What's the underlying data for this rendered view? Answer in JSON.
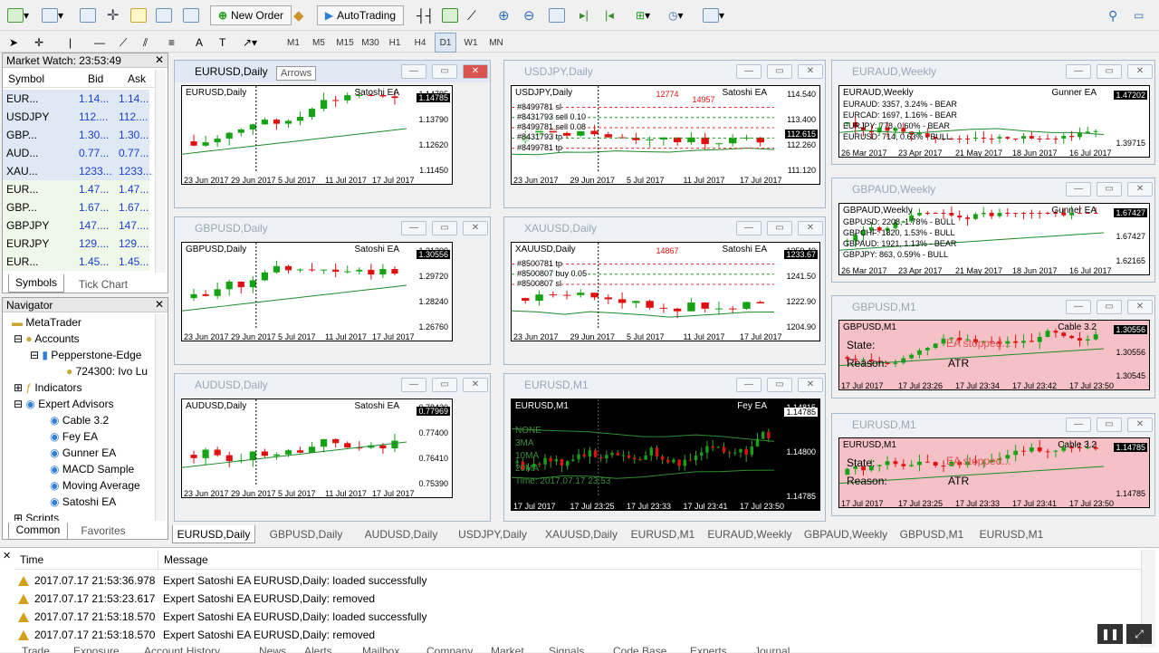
{
  "toolbar": {
    "new_order": "New Order",
    "autotrading": "AutoTrading"
  },
  "timeframes": [
    "M1",
    "M5",
    "M15",
    "M30",
    "H1",
    "H4",
    "D1",
    "W1",
    "MN"
  ],
  "market_watch": {
    "title": "Market Watch: 23:53:49",
    "headers": {
      "symbol": "Symbol",
      "bid": "Bid",
      "ask": "Ask"
    },
    "rows": [
      {
        "symbol": "EUR...",
        "bid": "1.14...",
        "ask": "1.14..."
      },
      {
        "symbol": "USDJPY",
        "bid": "112....",
        "ask": "112...."
      },
      {
        "symbol": "GBP...",
        "bid": "1.30...",
        "ask": "1.30..."
      },
      {
        "symbol": "AUD...",
        "bid": "0.77...",
        "ask": "0.77..."
      },
      {
        "symbol": "XAU...",
        "bid": "1233....",
        "ask": "1233...."
      },
      {
        "symbol": "EUR...",
        "bid": "1.47...",
        "ask": "1.47..."
      },
      {
        "symbol": "GBP...",
        "bid": "1.67...",
        "ask": "1.67..."
      },
      {
        "symbol": "GBPJPY",
        "bid": "147....",
        "ask": "147...."
      },
      {
        "symbol": "EURJPY",
        "bid": "129....",
        "ask": "129...."
      },
      {
        "symbol": "EUR...",
        "bid": "1.45...",
        "ask": "1.45..."
      }
    ],
    "tabs": [
      "Symbols",
      "Tick Chart"
    ]
  },
  "navigator": {
    "title": "Navigator",
    "items": [
      "MetaTrader",
      "Accounts",
      "Pepperstone-Edge",
      "724300: Ivo Lu",
      "Indicators",
      "Expert Advisors",
      "Cable 3.2",
      "Fey EA",
      "Gunner EA",
      "MACD Sample",
      "Moving Average",
      "Satoshi EA",
      "Scripts"
    ],
    "tabs": [
      "Common",
      "Favorites"
    ]
  },
  "charts": [
    {
      "title": "EURUSD,Daily",
      "label": "EURUSD,Daily",
      "ea": "Satoshi EA",
      "prices": [
        "1.14785",
        "1.13790",
        "1.12620",
        "1.11450"
      ],
      "dates": [
        "23 Jun 2017",
        "29 Jun 2017",
        "5 Jul 2017",
        "11 Jul 2017",
        "17 Jul 2017"
      ],
      "tag": "1.14785",
      "tooltip": "Arrows"
    },
    {
      "title": "USDJPY,Daily",
      "label": "USDJPY,Daily",
      "ea": "Satoshi EA",
      "prices": [
        "114.540",
        "113.400",
        "112.260",
        "111.120"
      ],
      "dates": [
        "23 Jun 2017",
        "29 Jun 2017",
        "5 Jul 2017",
        "11 Jul 2017",
        "17 Jul 2017"
      ],
      "tag": "112.615",
      "orders": [
        "#8499781 sl",
        "#8431793 sell 0.10",
        "#8499781 sell 0.08",
        "#8431793 tp",
        "#8499781 tp"
      ],
      "marks": [
        "12774",
        "14957"
      ]
    },
    {
      "title": "GBPUSD,Daily",
      "label": "GBPUSD,Daily",
      "ea": "Satoshi EA",
      "prices": [
        "1.31200",
        "1.29720",
        "1.28240",
        "1.26760"
      ],
      "dates": [
        "23 Jun 2017",
        "29 Jun 2017",
        "5 Jul 2017",
        "11 Jul 2017",
        "17 Jul 2017"
      ],
      "tag": "1.30556"
    },
    {
      "title": "XAUUSD,Daily",
      "label": "XAUUSD,Daily",
      "ea": "Satoshi EA",
      "prices": [
        "1259.40",
        "1241.50",
        "1222.90",
        "1204.90"
      ],
      "dates": [
        "23 Jun 2017",
        "29 Jun 2017",
        "5 Jul 2017",
        "11 Jul 2017",
        "17 Jul 2017"
      ],
      "tag": "1233.67",
      "orders": [
        "#8500781 tp",
        "#8500807 buy 0.05",
        "#8500807 sl"
      ],
      "marks": [
        "14867"
      ]
    },
    {
      "title": "AUDUSD,Daily",
      "label": "AUDUSD,Daily",
      "ea": "Satoshi EA",
      "prices": [
        "0.78420",
        "0.77400",
        "0.76410",
        "0.75390"
      ],
      "dates": [
        "23 Jun 2017",
        "29 Jun 2017",
        "5 Jul 2017",
        "11 Jul 2017",
        "17 Jul 2017"
      ],
      "tag": "0.77969"
    },
    {
      "title": "EURUSD,M1",
      "label": "EURUSD,M1",
      "ea": "Fey EA",
      "prices": [
        "1.14815",
        "1.14800",
        "1.14785"
      ],
      "dates": [
        "17 Jul 2017",
        "17 Jul 23:25",
        "17 Jul 23:33",
        "17 Jul 23:41",
        "17 Jul 23:50"
      ],
      "tag": "1.14785",
      "overlay": [
        "NONE",
        "3MA",
        "10MA",
        "20MA",
        "Time: 2017.07.17 23:53"
      ]
    },
    {
      "title": "EURAUD,Weekly",
      "label": "EURAUD,Weekly",
      "ea": "Gunner EA",
      "prices": [
        "1.47202",
        "1.39715"
      ],
      "dates": [
        "26 Mar 2017",
        "23 Apr 2017",
        "21 May 2017",
        "18 Jun 2017",
        "16 Jul 2017"
      ],
      "tag": "1.47202",
      "info": [
        "EURAUD: 3357, 3.24% - BEAR",
        "EURCAD: 1697, 1.16% - BEAR",
        "EURJPY: 778, 0.60% - BEAR",
        "EURUSD: 714, 0.63% - BULL"
      ]
    },
    {
      "title": "GBPAUD,Weekly",
      "label": "GBPAUD,Weekly",
      "ea": "Gunner EA",
      "prices": [
        "1.70495",
        "1.67427",
        "1.62165"
      ],
      "dates": [
        "26 Mar 2017",
        "23 Apr 2017",
        "21 May 2017",
        "18 Jun 2017",
        "16 Jul 2017"
      ],
      "tag": "1.67427",
      "info": [
        "GBPUSD: 2208, 1.78% - BULL",
        "GBPCHF: 1820, 1.53% - BULL",
        "GBPAUD: 1921, 1.13% - BEAR",
        "GBPJPY: 863, 0.59% - BULL"
      ]
    },
    {
      "title": "GBPUSD,M1",
      "label": "GBPUSD,M1",
      "ea": "Cable 3.2",
      "prices": [
        "1.30580",
        "1.30556",
        "1.30545"
      ],
      "dates": [
        "17 Jul 2017",
        "17 Jul 23:26",
        "17 Jul 23:34",
        "17 Jul 23:42",
        "17 Jul 23:50"
      ],
      "tag": "1.30556",
      "state_label": "State:",
      "state": "EA stopped...",
      "reason_label": "Reason:",
      "reason": "ATR"
    },
    {
      "title": "EURUSD,M1",
      "label": "EURUSD,M1",
      "ea": "Cable 3.2",
      "prices": [
        "1.14810",
        "1.14785"
      ],
      "dates": [
        "17 Jul 2017",
        "17 Jul 23:25",
        "17 Jul 23:33",
        "17 Jul 23:41",
        "17 Jul 23:50"
      ],
      "tag": "1.14785",
      "state_label": "State:",
      "state": "EA stopped...",
      "reason_label": "Reason:",
      "reason": "ATR"
    }
  ],
  "chart_tabs": [
    "EURUSD,Daily",
    "GBPUSD,Daily",
    "AUDUSD,Daily",
    "USDJPY,Daily",
    "XAUUSD,Daily",
    "EURUSD,M1",
    "EURAUD,Weekly",
    "GBPAUD,Weekly",
    "GBPUSD,M1",
    "EURUSD,M1"
  ],
  "journal": {
    "headers": {
      "time": "Time",
      "message": "Message"
    },
    "rows": [
      {
        "time": "2017.07.17 21:53:36.978",
        "message": "Expert Satoshi EA EURUSD,Daily: loaded successfully"
      },
      {
        "time": "2017.07.17 21:53:23.617",
        "message": "Expert Satoshi EA EURUSD,Daily: removed"
      },
      {
        "time": "2017.07.17 21:53:18.570",
        "message": "Expert Satoshi EA EURUSD,Daily: loaded successfully"
      },
      {
        "time": "2017.07.17 21:53:18.570",
        "message": "Expert Satoshi EA EURUSD,Daily: removed"
      }
    ],
    "tabs": [
      "Trade",
      "Exposure",
      "Account History",
      "News",
      "Alerts",
      "Mailbox",
      "Company",
      "Market",
      "Signals",
      "Code Base",
      "Experts",
      "Journal"
    ]
  }
}
